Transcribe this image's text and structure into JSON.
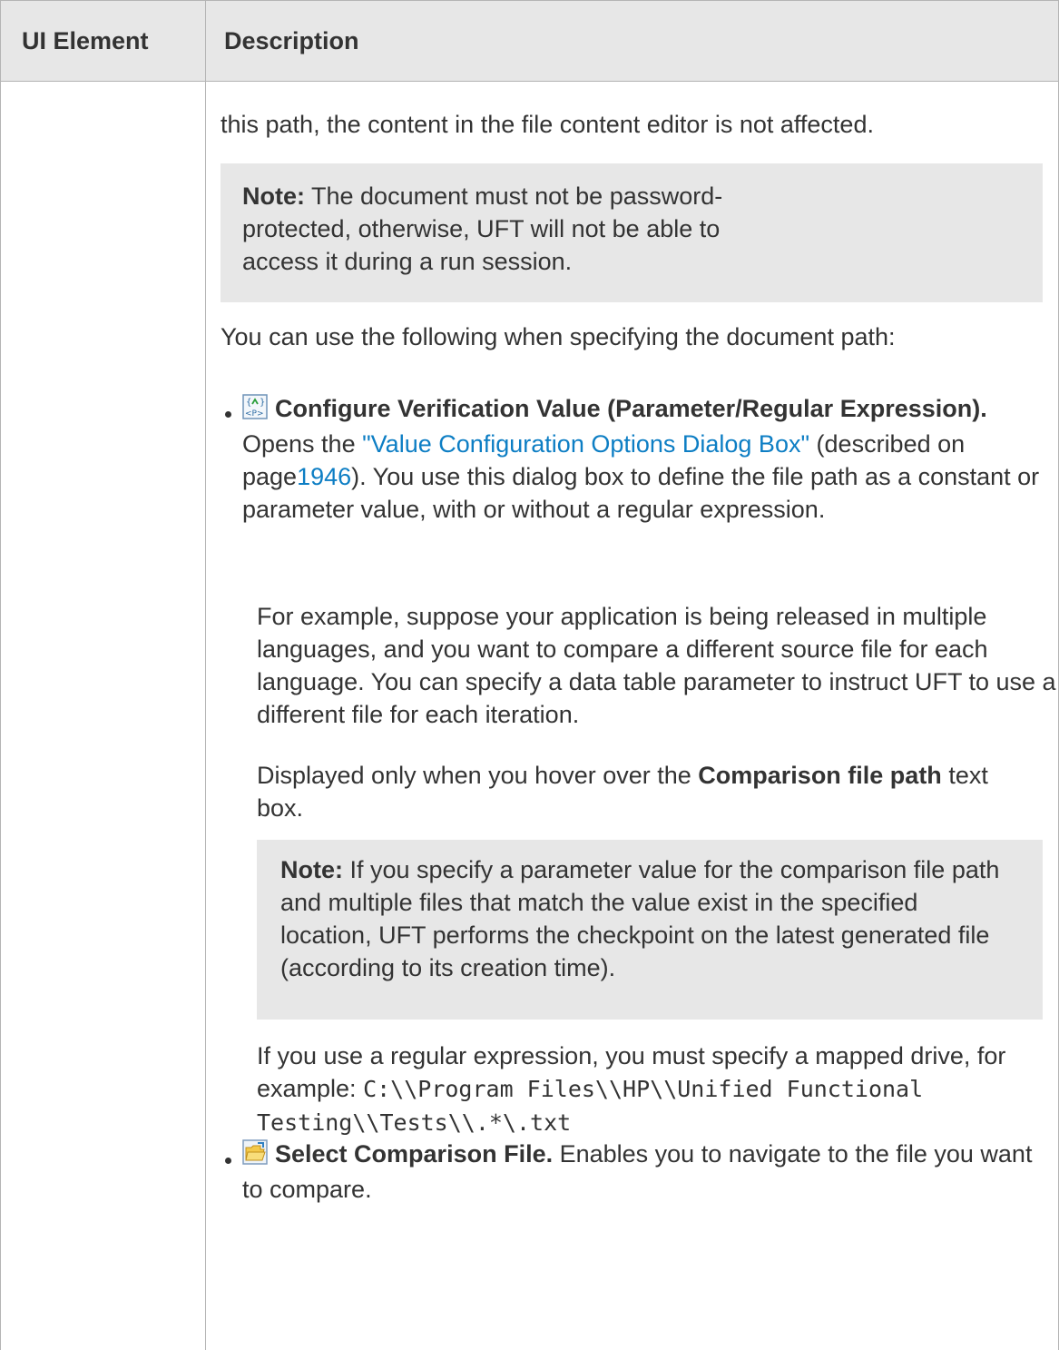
{
  "table": {
    "headers": {
      "ui_element": "UI Element",
      "description": "Description"
    }
  },
  "content": {
    "intro_line": "this path, the content in the file content editor is not affected.",
    "note1": {
      "label": "Note:",
      "text": " The document must not be password-protected, otherwise, UFT will not be able to access it during a run session."
    },
    "path_intro": "You can use the following when specifying the document path:",
    "item1": {
      "icon": "parameter-regex-icon",
      "title": "Configure Verification Value (Parameter/Regular Expression).",
      "text_before_link": " Opens the ",
      "link_text": "\"Value Configuration Options Dialog Box\"",
      "text_after_link": " (described on page",
      "page_number": "1946",
      "text_end": "). You use this dialog box to define the file path as a constant or parameter value, with or without a regular expression.",
      "example_para": "For example, suppose your application is being released in multiple languages, and you want to compare a different source file for each language. You can specify a data table parameter to instruct UFT to use a different file for each iteration.",
      "displayed_prefix": "Displayed only when you hover over the ",
      "displayed_bold": "Comparison file path",
      "displayed_suffix": " text box.",
      "note2": {
        "label": "Note:",
        "text": " If you specify a parameter value for the comparison file path and multiple files that match the value exist in the specified location, UFT performs the checkpoint on the latest generated file (according to its creation time)."
      },
      "regex_text": "If you use a regular expression, you must specify a mapped drive, for example: ",
      "regex_code": "C:\\\\Program Files\\\\HP\\\\Unified Functional Testing\\\\Tests\\\\.*\\.txt"
    },
    "item2": {
      "icon": "folder-open-icon",
      "title": "Select Comparison File.",
      "text": " Enables you to navigate to the file you want to compare."
    }
  },
  "colors": {
    "text": "#333333",
    "link": "#0d7ec4",
    "header_bg": "#e7e7e7",
    "note_bg": "#e7e7e7",
    "border": "#b4b4b4"
  }
}
